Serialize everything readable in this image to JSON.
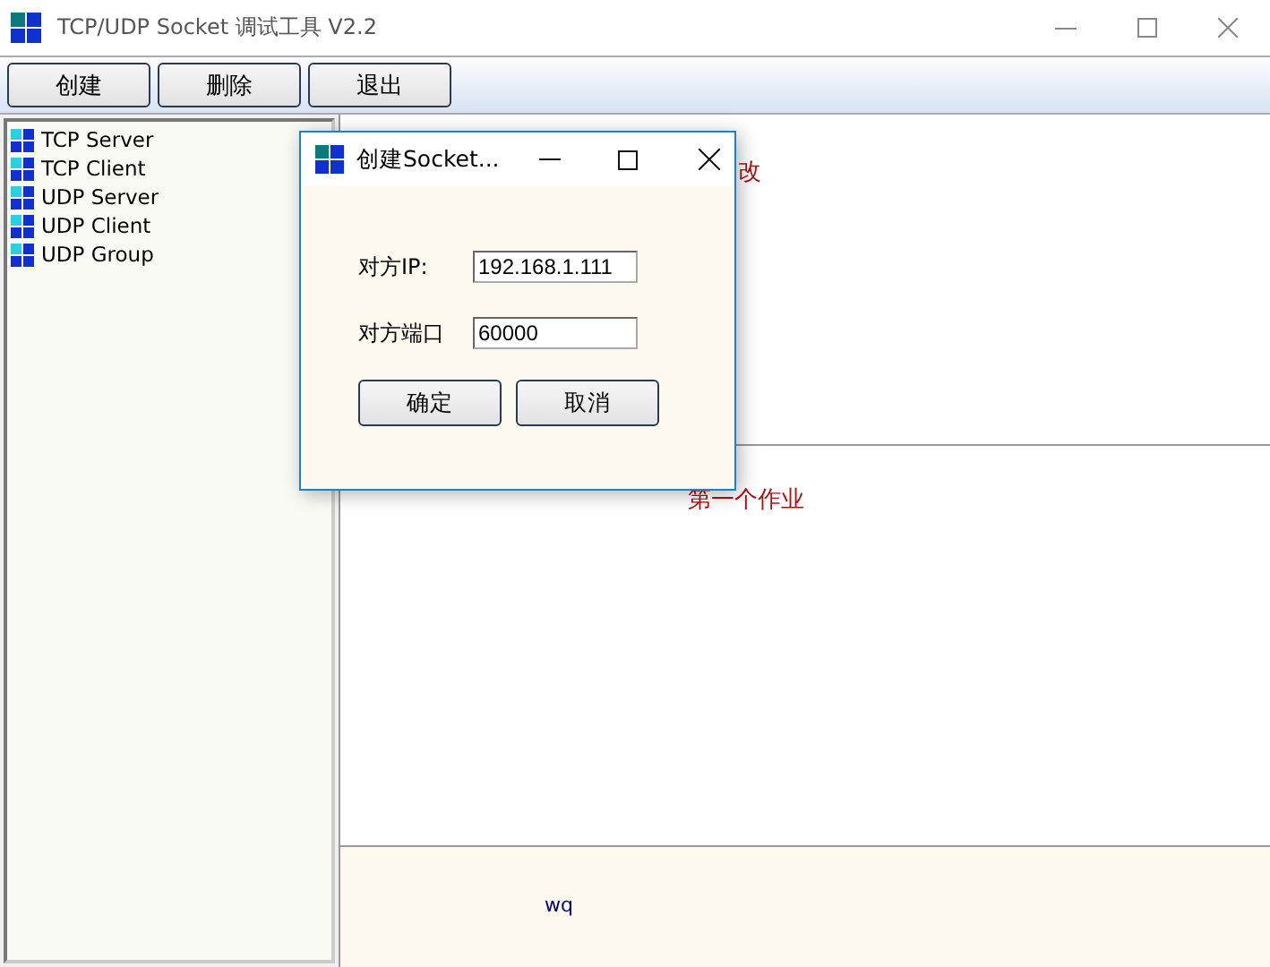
{
  "window": {
    "title": "TCP/UDP Socket 调试工具 V2.2"
  },
  "toolbar": {
    "buttons": [
      "创建",
      "删除",
      "退出"
    ]
  },
  "tree": {
    "items": [
      {
        "label": "TCP Server"
      },
      {
        "label": "TCP Client"
      },
      {
        "label": "UDP Server"
      },
      {
        "label": "UDP Client"
      },
      {
        "label": "UDP Group"
      }
    ]
  },
  "top_pane": {
    "text": "改"
  },
  "middle_pane": {
    "text": "第一个作业"
  },
  "bottom_pane": {
    "text": "wq"
  },
  "dialog": {
    "title": "创建Socket...",
    "fields": [
      {
        "label": "对方IP:",
        "value": "192.168.1.111"
      },
      {
        "label": "对方端口",
        "value": "60000"
      }
    ],
    "buttons": [
      "确定",
      "取消"
    ]
  }
}
